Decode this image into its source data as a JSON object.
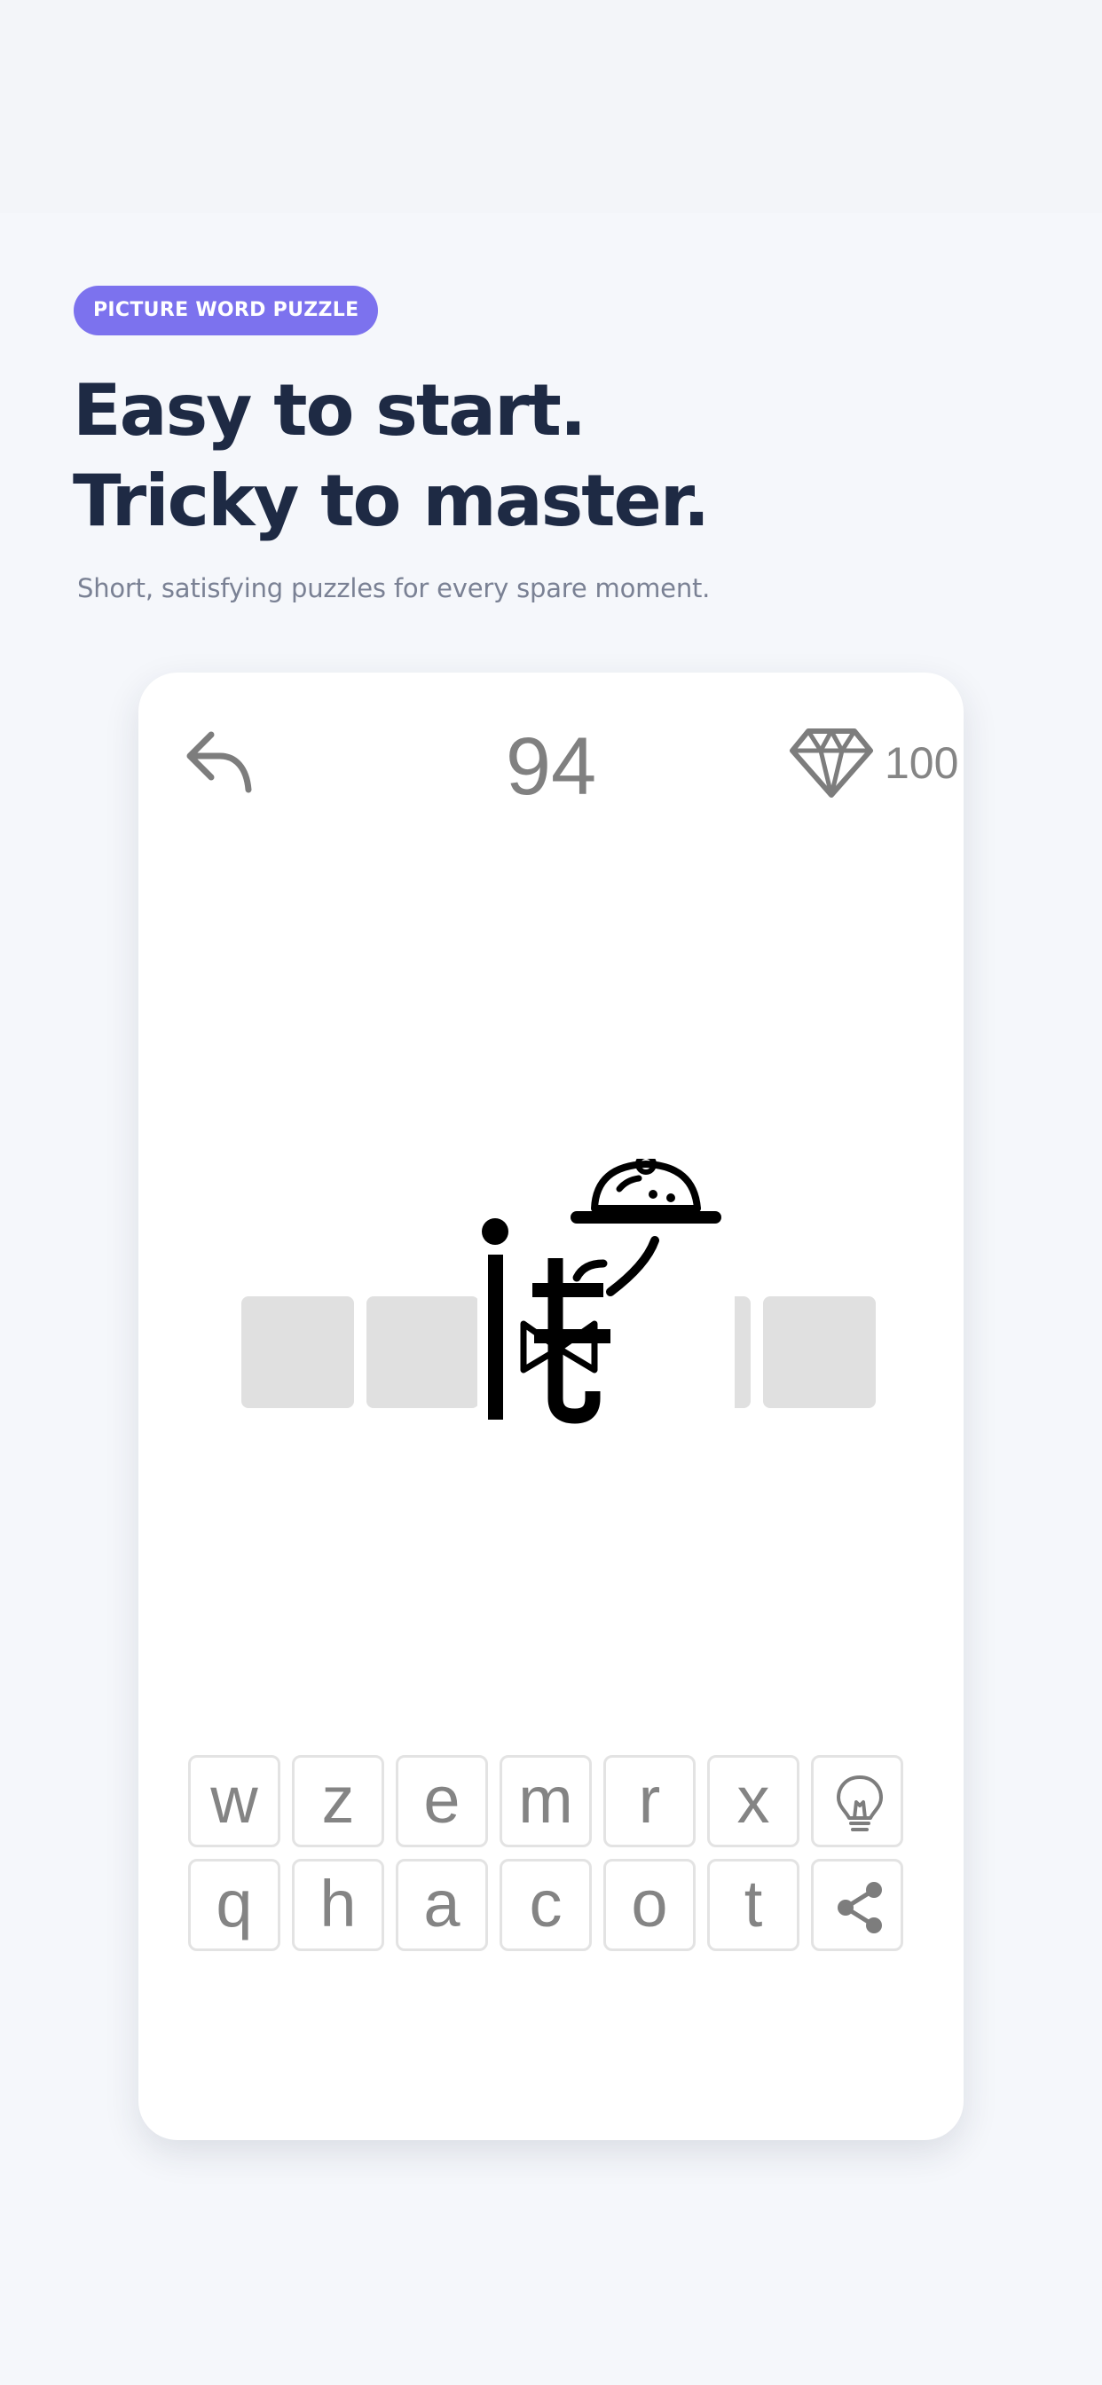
{
  "promo": {
    "badge": "PICTURE WORD PUZZLE",
    "headline_line1": "Easy to start.",
    "headline_line2": "Tricky to master.",
    "subhead": "Short, satisfying puzzles for every spare moment."
  },
  "game": {
    "level": "94",
    "gems": "100",
    "icons": {
      "back": "back-arrow-icon",
      "gems": "diamond-icon",
      "hint": "lightbulb-icon",
      "share": "share-icon",
      "clue": "waiter-serving-tray-picture"
    },
    "answer_slots": 6,
    "keyboard": {
      "row1": [
        "w",
        "z",
        "e",
        "m",
        "r",
        "x"
      ],
      "row2": [
        "q",
        "h",
        "a",
        "c",
        "o",
        "t"
      ]
    }
  },
  "colors": {
    "badge": "#7c72ee",
    "headline": "#1e2a44",
    "subhead": "#7a8194",
    "slot": "#e0e0e0",
    "key_text": "#848484"
  }
}
